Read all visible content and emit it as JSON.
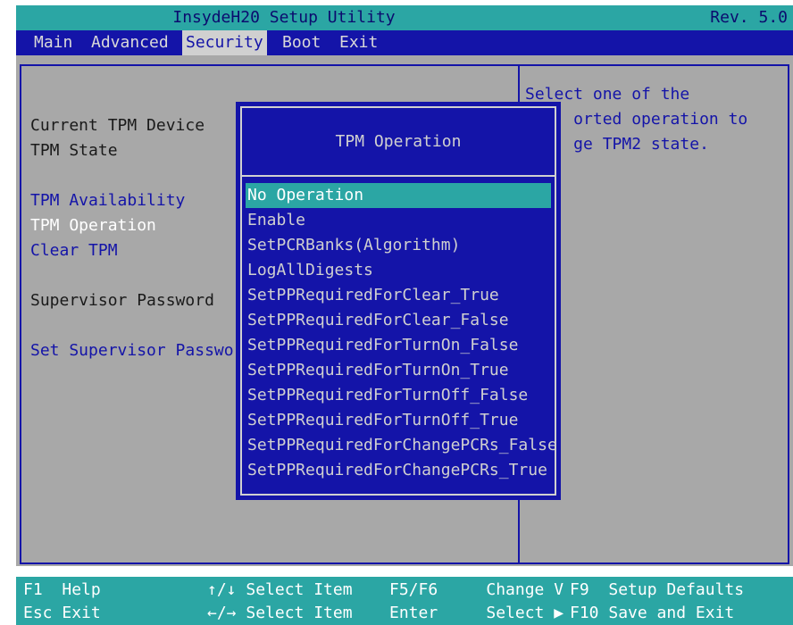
{
  "titlebar": {
    "title": "InsydeH20 Setup Utility",
    "rev": "Rev. 5.0"
  },
  "menu": {
    "main": "Main",
    "advanced": "Advanced",
    "security": "Security",
    "boot": "Boot",
    "exit": "Exit"
  },
  "left": {
    "current_tpm": "Current TPM Device",
    "tpm_state": "TPM State",
    "tpm_availability": "TPM Availability",
    "tpm_operation": "TPM Operation",
    "clear_tpm": "Clear TPM",
    "supervisor_password": "Supervisor Password",
    "set_supervisor_password": "Set Supervisor Passwor"
  },
  "help_text": "Select one of the\n     orted operation to\n     ge TPM2 state.",
  "popup": {
    "title": "TPM Operation",
    "options": [
      "No Operation",
      "Enable",
      "SetPCRBanks(Algorithm)",
      "LogAllDigests",
      "SetPPRequiredForClear_True",
      "SetPPRequiredForClear_False",
      "SetPPRequiredForTurnOn_False",
      "SetPPRequiredForTurnOn_True",
      "SetPPRequiredForTurnOff_False",
      "SetPPRequiredForTurnOff_True",
      "SetPPRequiredForChangePCRs_False",
      "SetPPRequiredForChangePCRs_True"
    ]
  },
  "footer": {
    "f1_key": "F1",
    "f1_desc": "Help",
    "esc_key": "Esc",
    "esc_desc": "Exit",
    "updown_key": "↑/↓",
    "updown_desc": "Select Item",
    "leftright_key": "←/→",
    "leftright_desc": "Select Item",
    "f5f6_key": "F5/F6",
    "f5f6_desc": "Change V",
    "enter_key": "Enter",
    "enter_desc": "Select ▶",
    "f9_key": "F9",
    "f9_desc": "Setup Defaults",
    "f10_key": "F10",
    "f10_desc": "Save and Exit"
  }
}
